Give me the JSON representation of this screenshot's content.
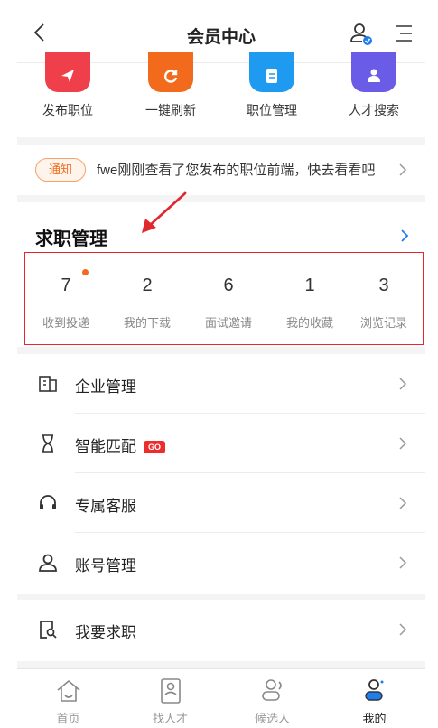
{
  "header": {
    "title": "会员中心"
  },
  "quick_actions": [
    {
      "label": "发布职位",
      "icon": "send-icon",
      "color": "#ef3f4a"
    },
    {
      "label": "一键刷新",
      "icon": "refresh-icon",
      "color": "#f26b1d"
    },
    {
      "label": "职位管理",
      "icon": "document-icon",
      "color": "#1e9bf0"
    },
    {
      "label": "人才搜索",
      "icon": "people-icon",
      "color": "#6b5ce7"
    }
  ],
  "notice": {
    "tag": "通知",
    "text": "fwe刚刚查看了您发布的职位前端，快去看看吧"
  },
  "job_management": {
    "title": "求职管理",
    "stats": [
      {
        "value": "7",
        "label": "收到投递",
        "has_dot": true
      },
      {
        "value": "2",
        "label": "我的下载"
      },
      {
        "value": "6",
        "label": "面试邀请"
      },
      {
        "value": "1",
        "label": "我的收藏"
      },
      {
        "value": "3",
        "label": "浏览记录"
      }
    ]
  },
  "menu": [
    {
      "label": "企业管理",
      "icon": "building-icon"
    },
    {
      "label": "智能匹配",
      "icon": "hourglass-icon",
      "badge": "GO"
    },
    {
      "label": "专属客服",
      "icon": "headset-icon"
    },
    {
      "label": "账号管理",
      "icon": "user-icon"
    }
  ],
  "menu2": [
    {
      "label": "我要求职",
      "icon": "resume-search-icon"
    }
  ],
  "tabbar": [
    {
      "label": "首页",
      "icon": "home-icon"
    },
    {
      "label": "找人才",
      "icon": "id-card-icon"
    },
    {
      "label": "候选人",
      "icon": "candidates-icon"
    },
    {
      "label": "我的",
      "icon": "profile-icon",
      "active": true
    }
  ],
  "colors": {
    "accent_blue": "#1e7ef0",
    "highlight_red": "#e0282e",
    "notice_orange": "#f26b1d"
  }
}
